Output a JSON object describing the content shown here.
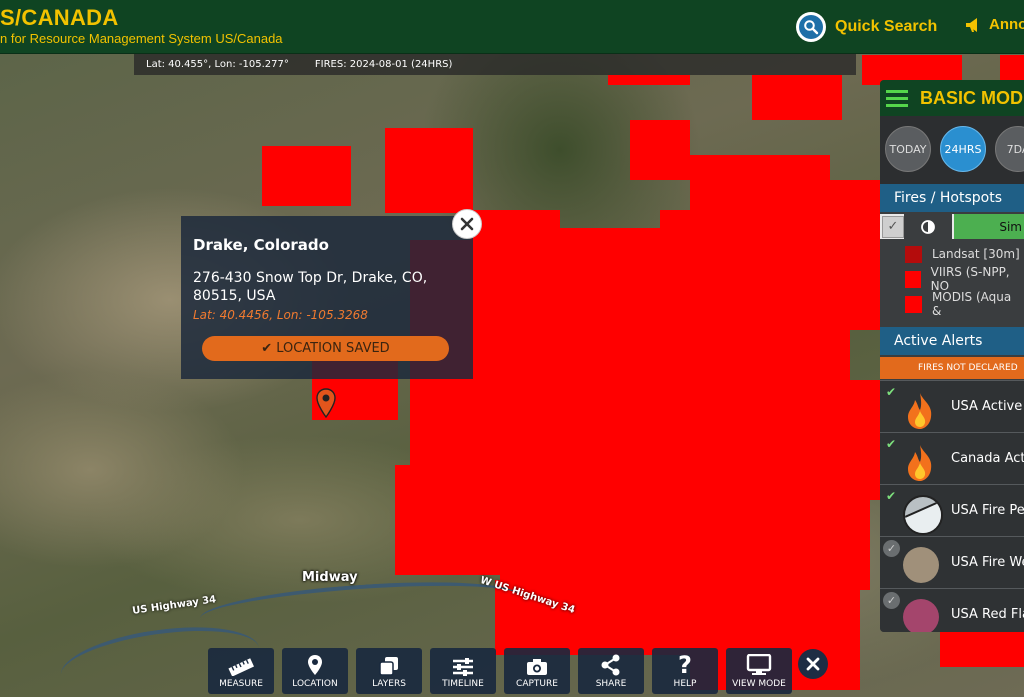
{
  "header": {
    "title": "S/CANADA",
    "subtitle": "n for Resource Management System US/Canada",
    "quick_search_label": "Quick Search",
    "announcements_label": "Anno"
  },
  "coords_bar": {
    "latlon": "Lat: 40.455°, Lon: -105.277°",
    "fires": "FIRES: 2024-08-01 (24HRS)"
  },
  "popup": {
    "title": "Drake, Colorado",
    "address": "276-430 Snow Top Dr, Drake, CO, 80515, USA",
    "latlon": "Lat: 40.4456, Lon: -105.3268",
    "saved_label": "LOCATION SAVED"
  },
  "map_labels": {
    "midway": "Midway",
    "highway_34_east": "W US Highway 34",
    "highway_34_west": "US Highway 34"
  },
  "panel": {
    "title": "BASIC MOD",
    "time_buttons": [
      "TODAY",
      "24HRS",
      "7DA"
    ],
    "active_time": "24HRS",
    "fires_section": "Fires / Hotspots",
    "fire_tool_label": "Sim",
    "legend": [
      {
        "label": "Landsat [30m]",
        "color": "#b40c0c"
      },
      {
        "label": "VIIRS (S-NPP, NO",
        "color": "#ff0000"
      },
      {
        "label": "MODIS (Aqua &",
        "color": "#ff0000"
      }
    ],
    "alerts_section": "Active Alerts",
    "alerts_sub": "FIRES NOT DECLARED",
    "alerts": [
      {
        "label": "USA Active",
        "checked": true,
        "icon": "fire-icon"
      },
      {
        "label": "Canada Act",
        "checked": true,
        "icon": "fire-icon"
      },
      {
        "label": "USA Fire Pe",
        "checked": true,
        "icon": "fire-perimeter-icon"
      },
      {
        "label": "USA Fire We",
        "checked": false,
        "icon": "fire-weather-icon"
      },
      {
        "label": "USA Red Fla",
        "checked": false,
        "icon": "red-flag-icon"
      }
    ]
  },
  "toolbar": {
    "tools": [
      "MEASURE",
      "LOCATION",
      "LAYERS",
      "TIMELINE",
      "CAPTURE",
      "SHARE",
      "HELP",
      "VIEW MODE"
    ]
  },
  "colors": {
    "header_green": "#0f4422",
    "brand_yellow": "#f2c200",
    "fire_red": "#ff0000",
    "alert_orange": "#e26a1c",
    "section_blue": "#1f5f86"
  }
}
